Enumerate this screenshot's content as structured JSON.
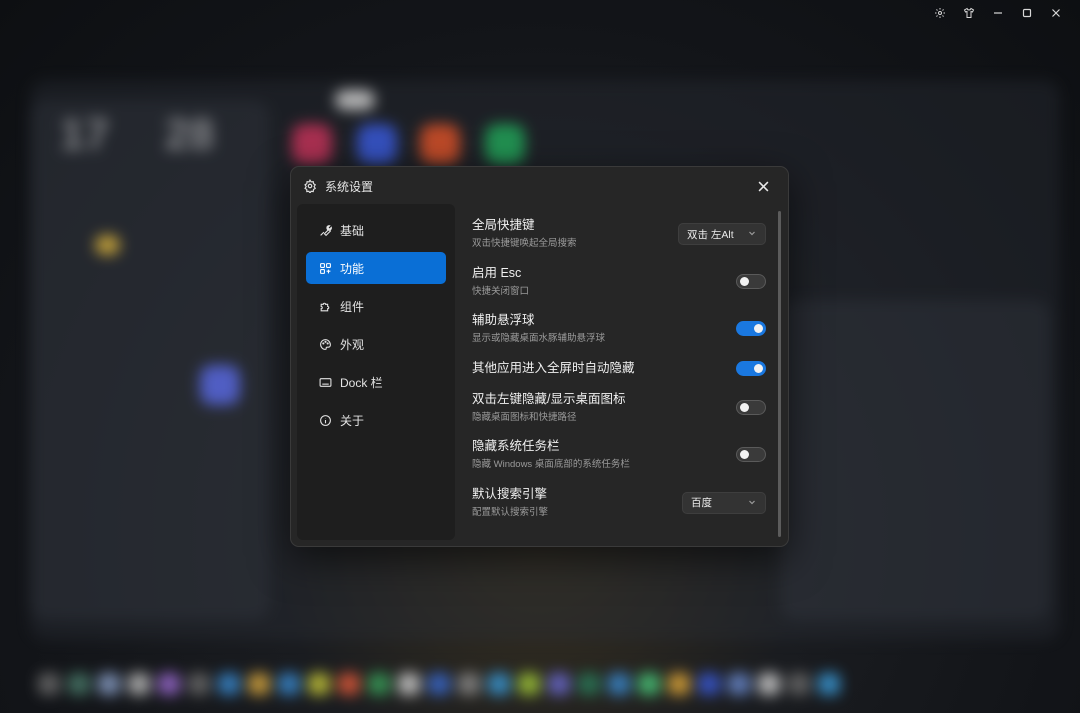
{
  "window_controls": {
    "settings_icon": "gear-icon",
    "skin_icon": "shirt-icon",
    "minimize_icon": "minimize-icon",
    "maximize_icon": "maximize-icon",
    "close_icon": "close-icon"
  },
  "dialog": {
    "title": "系统设置",
    "sidebar": {
      "items": [
        {
          "label": "基础",
          "icon": "wrench-icon",
          "active": false
        },
        {
          "label": "功能",
          "icon": "function-icon",
          "active": true
        },
        {
          "label": "组件",
          "icon": "puzzle-icon",
          "active": false
        },
        {
          "label": "外观",
          "icon": "palette-icon",
          "active": false
        },
        {
          "label": "Dock 栏",
          "icon": "dock-icon",
          "active": false
        },
        {
          "label": "关于",
          "icon": "info-icon",
          "active": false
        }
      ]
    },
    "settings": [
      {
        "title": "全局快捷键",
        "desc": "双击快捷键唤起全局搜索",
        "control": "select",
        "value": "双击 左Alt"
      },
      {
        "title": "启用 Esc",
        "desc": "快捷关闭窗口",
        "control": "toggle",
        "on": false
      },
      {
        "title": "辅助悬浮球",
        "desc": "显示或隐藏桌面水豚辅助悬浮球",
        "control": "toggle",
        "on": true
      },
      {
        "title": "其他应用进入全屏时自动隐藏",
        "desc": "",
        "control": "toggle",
        "on": true
      },
      {
        "title": "双击左键隐藏/显示桌面图标",
        "desc": "隐藏桌面图标和快捷路径",
        "control": "toggle",
        "on": false
      },
      {
        "title": "隐藏系统任务栏",
        "desc": "隐藏 Windows 桌面底部的系统任务栏",
        "control": "toggle",
        "on": false
      },
      {
        "title": "默认搜索引擎",
        "desc": "配置默认搜索引擎",
        "control": "select",
        "value": "百度"
      }
    ]
  },
  "colors": {
    "accent": "#0a6fd6",
    "dialog_bg": "#262626",
    "sidebar_bg": "#1e1e1e"
  }
}
